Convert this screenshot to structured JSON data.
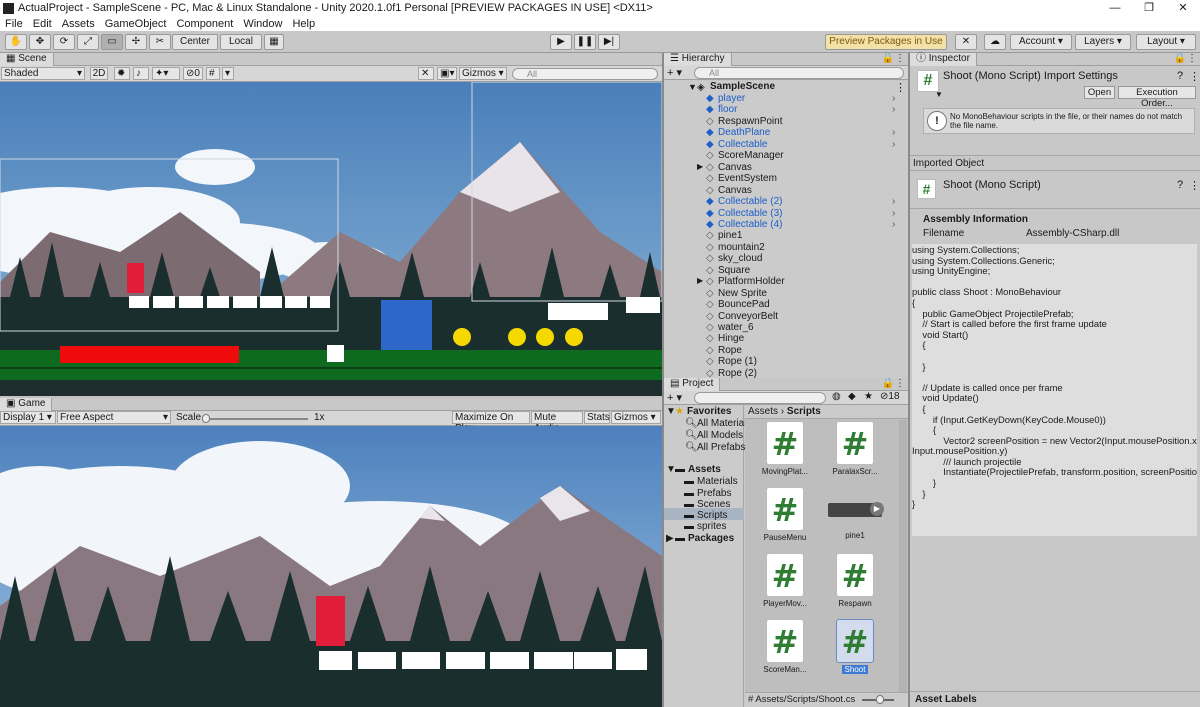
{
  "window": {
    "title": "ActualProject - SampleScene - PC, Mac & Linux Standalone - Unity 2020.1.0f1 Personal [PREVIEW PACKAGES IN USE] <DX11>",
    "controls": [
      "—",
      "❐",
      "✕"
    ]
  },
  "menu": [
    "File",
    "Edit",
    "Assets",
    "GameObject",
    "Component",
    "Window",
    "Help"
  ],
  "toolbar": {
    "pivot": "Center",
    "space": "Local",
    "preview_packages": "Preview Packages in Use",
    "account": "Account",
    "layers": "Layers",
    "layout": "Layout"
  },
  "scene": {
    "tab": "Scene",
    "draw_mode": "Shaded",
    "mode_2d": "2D",
    "hidden_count": "0",
    "gizmos": "Gizmos",
    "search_placeholder": "All"
  },
  "game": {
    "tab": "Game",
    "display": "Display 1",
    "aspect": "Free Aspect",
    "scale_label": "Scale",
    "scale_value": "1x",
    "maximize": "Maximize On Play",
    "mute": "Mute Audio",
    "stats": "Stats",
    "gizmos": "Gizmos"
  },
  "hierarchy": {
    "tab": "Hierarchy",
    "search_placeholder": "All",
    "scene_name": "SampleScene",
    "items": [
      {
        "label": "player",
        "blue": true,
        "expand": true
      },
      {
        "label": "floor",
        "blue": true,
        "expand": true
      },
      {
        "label": "RespawnPoint",
        "blue": false,
        "expand": false
      },
      {
        "label": "DeathPlane",
        "blue": true,
        "expand": true
      },
      {
        "label": "Collectable",
        "blue": true,
        "expand": true
      },
      {
        "label": "ScoreManager",
        "blue": false,
        "expand": false
      },
      {
        "label": "Canvas",
        "blue": false,
        "expand": false,
        "arrow": true
      },
      {
        "label": "EventSystem",
        "blue": false,
        "expand": false
      },
      {
        "label": "Canvas",
        "blue": false,
        "expand": false
      },
      {
        "label": "Collectable (2)",
        "blue": true,
        "expand": true
      },
      {
        "label": "Collectable (3)",
        "blue": true,
        "expand": true
      },
      {
        "label": "Collectable (4)",
        "blue": true,
        "expand": true
      },
      {
        "label": "pine1",
        "blue": false,
        "expand": false
      },
      {
        "label": "mountain2",
        "blue": false,
        "expand": false
      },
      {
        "label": "sky_cloud",
        "blue": false,
        "expand": false
      },
      {
        "label": "Square",
        "blue": false,
        "expand": false
      },
      {
        "label": "PlatformHolder",
        "blue": false,
        "expand": false,
        "arrow": true
      },
      {
        "label": "New Sprite",
        "blue": false,
        "expand": false
      },
      {
        "label": "BouncePad",
        "blue": false,
        "expand": false
      },
      {
        "label": "ConveyorBelt",
        "blue": false,
        "expand": false
      },
      {
        "label": "water_6",
        "blue": false,
        "expand": false
      },
      {
        "label": "Hinge",
        "blue": false,
        "expand": false
      },
      {
        "label": "Rope",
        "blue": false,
        "expand": false
      },
      {
        "label": "Rope (1)",
        "blue": false,
        "expand": false
      },
      {
        "label": "Rope (2)",
        "blue": false,
        "expand": false
      }
    ]
  },
  "project": {
    "tab": "Project",
    "hidden_count": "18",
    "favorites_label": "Favorites",
    "favorites": [
      "All Materials",
      "All Models",
      "All Prefabs"
    ],
    "assets_label": "Assets",
    "folders": [
      "Materials",
      "Prefabs",
      "Scenes",
      "Scripts",
      "sprites"
    ],
    "packages_label": "Packages",
    "breadcrumb_root": "Assets",
    "breadcrumb_sep": "›",
    "breadcrumb_current": "Scripts",
    "assets": [
      {
        "label": "MovingPlat...",
        "type": "script"
      },
      {
        "label": "ParalaxScr...",
        "type": "script"
      },
      {
        "label": "PauseMenu",
        "type": "script"
      },
      {
        "label": "pine1",
        "type": "audio"
      },
      {
        "label": "PlayerMov...",
        "type": "script"
      },
      {
        "label": "Respawn",
        "type": "script"
      },
      {
        "label": "ScoreMan...",
        "type": "script"
      },
      {
        "label": "Shoot",
        "type": "script",
        "selected": true
      }
    ],
    "footer_path": "Assets/Scripts/Shoot.cs"
  },
  "inspector": {
    "tab": "Inspector",
    "title": "Shoot (Mono Script) Import Settings",
    "open_button": "Open",
    "exec_order_button": "Execution Order...",
    "warning": "No MonoBehaviour scripts in the file, or their names do not match the file name.",
    "imported_object": "Imported Object",
    "object_title": "Shoot (Mono Script)",
    "assembly_header": "Assembly Information",
    "filename_label": "Filename",
    "filename_value": "Assembly-CSharp.dll",
    "code": "using System.Collections;\nusing System.Collections.Generic;\nusing UnityEngine;\n\npublic class Shoot : MonoBehaviour\n{\n    public GameObject ProjectilePrefab;\n    // Start is called before the first frame update\n    void Start()\n    {\n\n    }\n\n    // Update is called once per frame\n    void Update()\n    {\n        if (Input.GetKeyDown(KeyCode.Mouse0))\n        {\n            Vector2 screenPosition = new Vector2(Input.mousePosition.x,\nInput.mousePosition.y)\n            /// launch projectile\n            Instantiate(ProjectilePrefab, transform.position, screenPosition);\n        }\n    }\n}",
    "asset_labels": "Asset Labels"
  },
  "colors": {
    "sky": "#5a89c0",
    "ground": "#0d6a1f",
    "player": "#e11d3a",
    "coin": "#f5d800",
    "accent_blue": "#1d5fc8"
  }
}
